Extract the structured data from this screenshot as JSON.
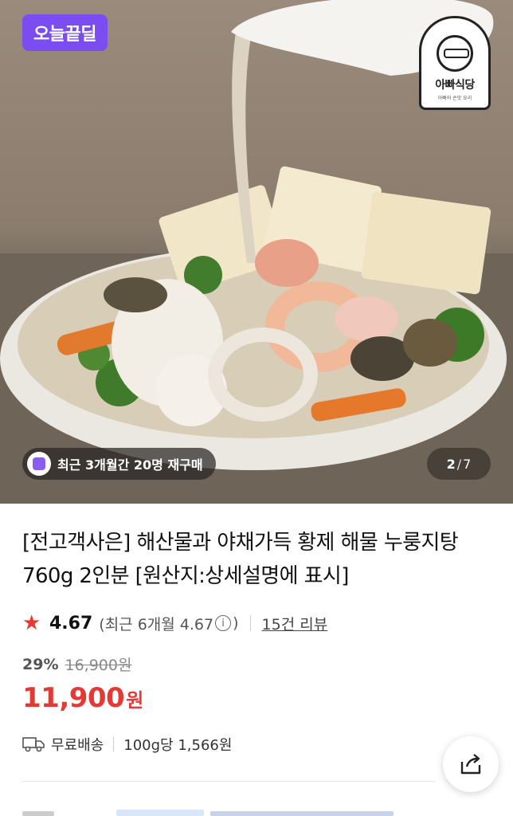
{
  "hero": {
    "deal_badge": "오늘끝딜",
    "brand_logo": {
      "name": "아빠식당",
      "sub": "아빠의 손맛 요리"
    },
    "rebuy_text": "최근 3개월간 20명 재구매",
    "pager": {
      "current": "2",
      "separator": "/",
      "total": "7"
    }
  },
  "product": {
    "title_line1": "[전고객사은] 해산물과 야채가득 황제 해물 누룽지탕",
    "title_line2": "760g 2인분 [원산지:상세설명에 표시]",
    "rating": "4.67",
    "rating_sub_prefix": "(최근 6개월 4.67",
    "rating_info_icon": "ⓘ",
    "rating_sub_suffix": ")",
    "review_link": "15건 리뷰",
    "discount_rate": "29%",
    "original_price": "16,900원",
    "price": "11,900",
    "price_unit": "원",
    "shipping": "무료배송",
    "unit_price": "100g당 1,566원"
  },
  "icons": {
    "star": "star-icon",
    "info": "info-icon",
    "truck": "truck-icon",
    "share": "share-icon"
  },
  "colors": {
    "deal_badge": "#7b4df0",
    "price": "#e53935",
    "star": "#e53935"
  }
}
